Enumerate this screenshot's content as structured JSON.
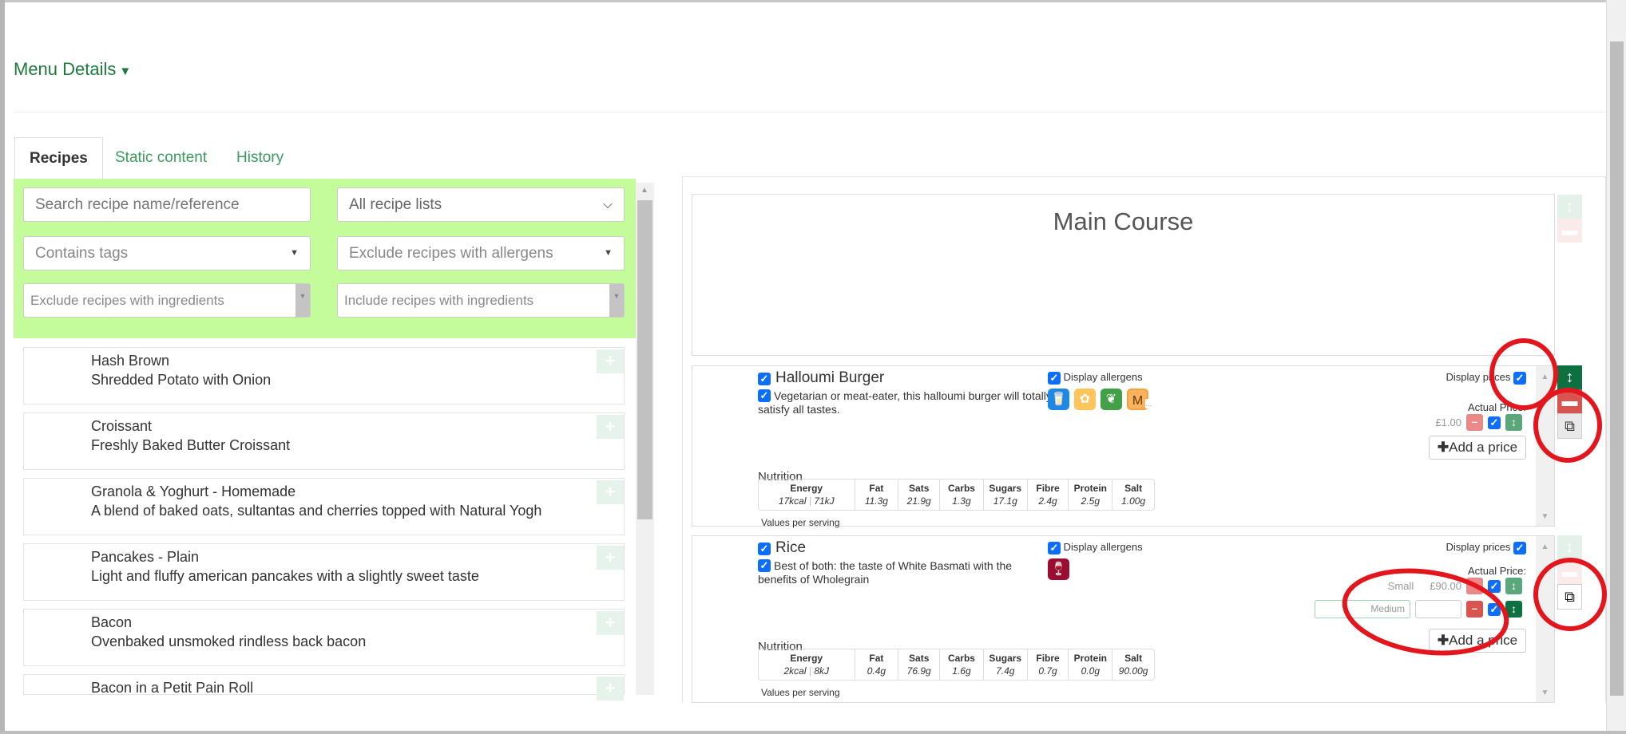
{
  "header": {
    "title": "Menu Details"
  },
  "tabs": [
    {
      "label": "Recipes",
      "active": true
    },
    {
      "label": "Static content"
    },
    {
      "label": "History"
    }
  ],
  "filters": {
    "search_placeholder": "Search recipe name/reference",
    "recipe_list": "All recipe lists",
    "contains_tags": "Contains tags",
    "exclude_allergens": "Exclude recipes with allergens",
    "exclude_ingredients": "Exclude recipes with ingredients",
    "include_ingredients": "Include recipes with ingredients"
  },
  "recipes": [
    {
      "name": "Hash Brown",
      "desc": "Shredded Potato with Onion"
    },
    {
      "name": "Croissant",
      "desc": "Freshly Baked Butter Croissant"
    },
    {
      "name": "Granola & Yoghurt - Homemade",
      "desc": "A blend of baked oats, sultantas and cherries topped with Natural Yogh"
    },
    {
      "name": "Pancakes - Plain",
      "desc": "Light and fluffy american pancakes with a slightly sweet taste"
    },
    {
      "name": "Bacon",
      "desc": "Ovenbaked unsmoked rindless back bacon"
    },
    {
      "name": "Bacon in a Petit Pain Roll",
      "desc": ""
    }
  ],
  "section": {
    "title": "Main Course"
  },
  "labels": {
    "display_allergens": "Display allergens",
    "display_prices": "Display prices",
    "actual_price": "Actual Price:",
    "add_price": "Add a price",
    "nutrition": "Nutrition",
    "values_per_serving": "Values per serving",
    "more": "..."
  },
  "nutrition_headers": [
    "Energy",
    "Fat",
    "Sats",
    "Carbs",
    "Sugars",
    "Fibre",
    "Protein",
    "Salt"
  ],
  "items": [
    {
      "title": "Halloumi Burger",
      "desc": "Vegetarian or meat-eater, this halloumi burger will totally satisfy all tastes.",
      "allergens": [
        {
          "icon": "milk-icon",
          "color": "#1e88e5"
        },
        {
          "icon": "cereal-icon",
          "color": "#fdc55b"
        },
        {
          "icon": "celery-icon",
          "color": "#43a047"
        },
        {
          "icon": "mustard-icon",
          "color": "#f7a040",
          "letter": "M"
        }
      ],
      "prices": [
        {
          "size": "",
          "price": "£1.00"
        }
      ],
      "nutrition": {
        "energy_kcal": "17kcal",
        "energy_kj": "71kJ",
        "values": [
          "11.3g",
          "21.9g",
          "1.3g",
          "17.1g",
          "2.4g",
          "2.5g",
          "1.00g"
        ]
      }
    },
    {
      "title": "Rice",
      "desc": "Best of both: the taste of White Basmati with the benefits of Wholegrain",
      "allergens": [
        {
          "icon": "wine-glass-icon",
          "color": "#9b0d33"
        }
      ],
      "prices": [
        {
          "size": "Small",
          "price": "£90.00"
        },
        {
          "size_placeholder": "Medium",
          "price": ""
        }
      ],
      "nutrition": {
        "energy_kcal": "2kcal",
        "energy_kj": "8kJ",
        "values": [
          "0.4g",
          "76.9g",
          "1.6g",
          "7.4g",
          "0.7g",
          "0.0g",
          "90.00g"
        ]
      }
    }
  ],
  "colors": {
    "accent": "#1e7a3c",
    "filter_bg": "#c4fb9b",
    "annotation": "#e3161d",
    "checkbox": "#0d6efd"
  }
}
